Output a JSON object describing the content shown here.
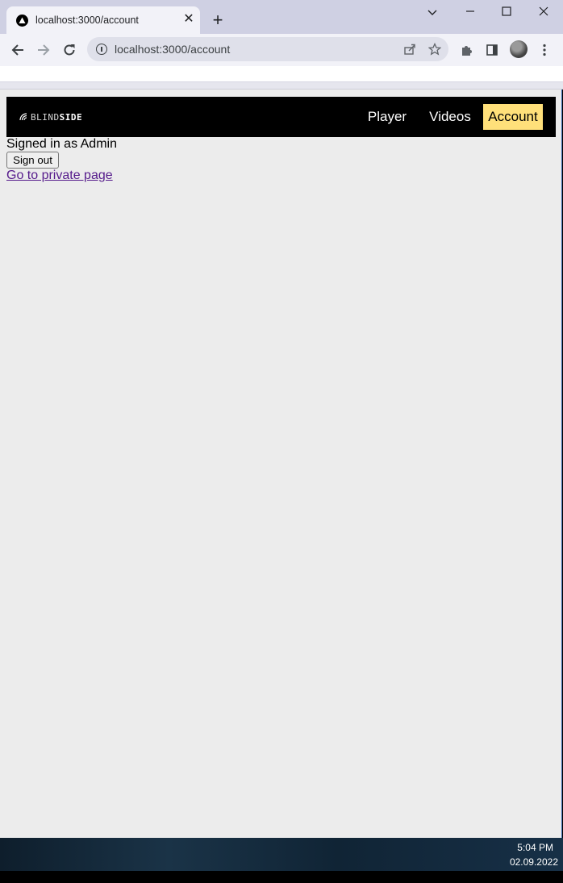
{
  "browser": {
    "tab_title": "localhost:3000/account",
    "tab_close": "✕",
    "new_tab": "+",
    "url": "localhost:3000/account",
    "icons": {
      "back": "arrow-left-icon",
      "forward": "arrow-right-icon",
      "reload": "reload-icon",
      "site_info": "info-icon",
      "share": "share-icon",
      "bookmark": "star-icon",
      "extensions": "puzzle-icon",
      "side_panel": "side-panel-icon",
      "menu": "kebab-menu-icon"
    }
  },
  "site": {
    "logo_part1": "BLIND",
    "logo_part2": "SIDE",
    "nav": [
      {
        "label": "Player",
        "active": false
      },
      {
        "label": "Videos",
        "active": false
      },
      {
        "label": "Account",
        "active": true
      }
    ],
    "accent_color": "#ffe07a"
  },
  "account": {
    "signed_in_text": "Signed in as Admin",
    "sign_out_label": "Sign out",
    "private_link_label": "Go to private page"
  },
  "taskbar": {
    "time": "5:04 PM",
    "date": "02.09.2022"
  }
}
